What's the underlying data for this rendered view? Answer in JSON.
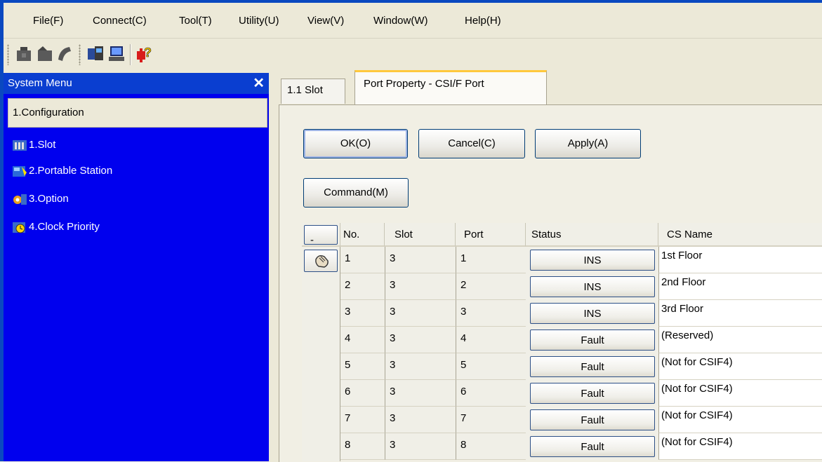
{
  "menu": {
    "items": [
      "File(F)",
      "Connect(C)",
      "Tool(T)",
      "Utility(U)",
      "View(V)",
      "Window(W)",
      "Help(H)"
    ]
  },
  "toolbar": {
    "icons": [
      "disconnect-icon",
      "connect-icon",
      "bell-icon",
      "station-icon",
      "terminal-icon",
      "help-icon"
    ]
  },
  "system_menu": {
    "title": "System Menu",
    "section": "1.Configuration",
    "items": [
      {
        "label": "1.Slot",
        "icon": "slot-icon"
      },
      {
        "label": "2.Portable Station",
        "icon": "portable-station-icon"
      },
      {
        "label": "3.Option",
        "icon": "option-icon"
      },
      {
        "label": "4.Clock Priority",
        "icon": "clock-priority-icon"
      }
    ]
  },
  "tabs": [
    {
      "label": "1.1 Slot",
      "active": false
    },
    {
      "label": "Port Property - CSI/F Port",
      "active": true
    }
  ],
  "buttons": {
    "ok": "OK(O)",
    "cancel": "Cancel(C)",
    "apply": "Apply(A)",
    "command": "Command(M)"
  },
  "grid": {
    "collapse_button": "-",
    "columns": [
      "No.",
      "Slot",
      "Port",
      "Status",
      "CS Name"
    ],
    "rows": [
      {
        "no": "1",
        "slot": "3",
        "port": "1",
        "status": "INS",
        "cs_name": "1st Floor"
      },
      {
        "no": "2",
        "slot": "3",
        "port": "2",
        "status": "INS",
        "cs_name": "2nd Floor"
      },
      {
        "no": "3",
        "slot": "3",
        "port": "3",
        "status": "INS",
        "cs_name": "3rd Floor"
      },
      {
        "no": "4",
        "slot": "3",
        "port": "4",
        "status": "Fault",
        "cs_name": "(Reserved)"
      },
      {
        "no": "5",
        "slot": "3",
        "port": "5",
        "status": "Fault",
        "cs_name": "(Not for CSIF4)"
      },
      {
        "no": "6",
        "slot": "3",
        "port": "6",
        "status": "Fault",
        "cs_name": "(Not for CSIF4)"
      },
      {
        "no": "7",
        "slot": "3",
        "port": "7",
        "status": "Fault",
        "cs_name": "(Not for CSIF4)"
      },
      {
        "no": "8",
        "slot": "3",
        "port": "8",
        "status": "Fault",
        "cs_name": "(Not for CSIF4)"
      }
    ]
  },
  "colors": {
    "frame_blue": "#0a48c0",
    "panel_blue": "#0000ee",
    "active_tab_accent": "#ffc83c",
    "window_bg": "#ece9d8"
  }
}
